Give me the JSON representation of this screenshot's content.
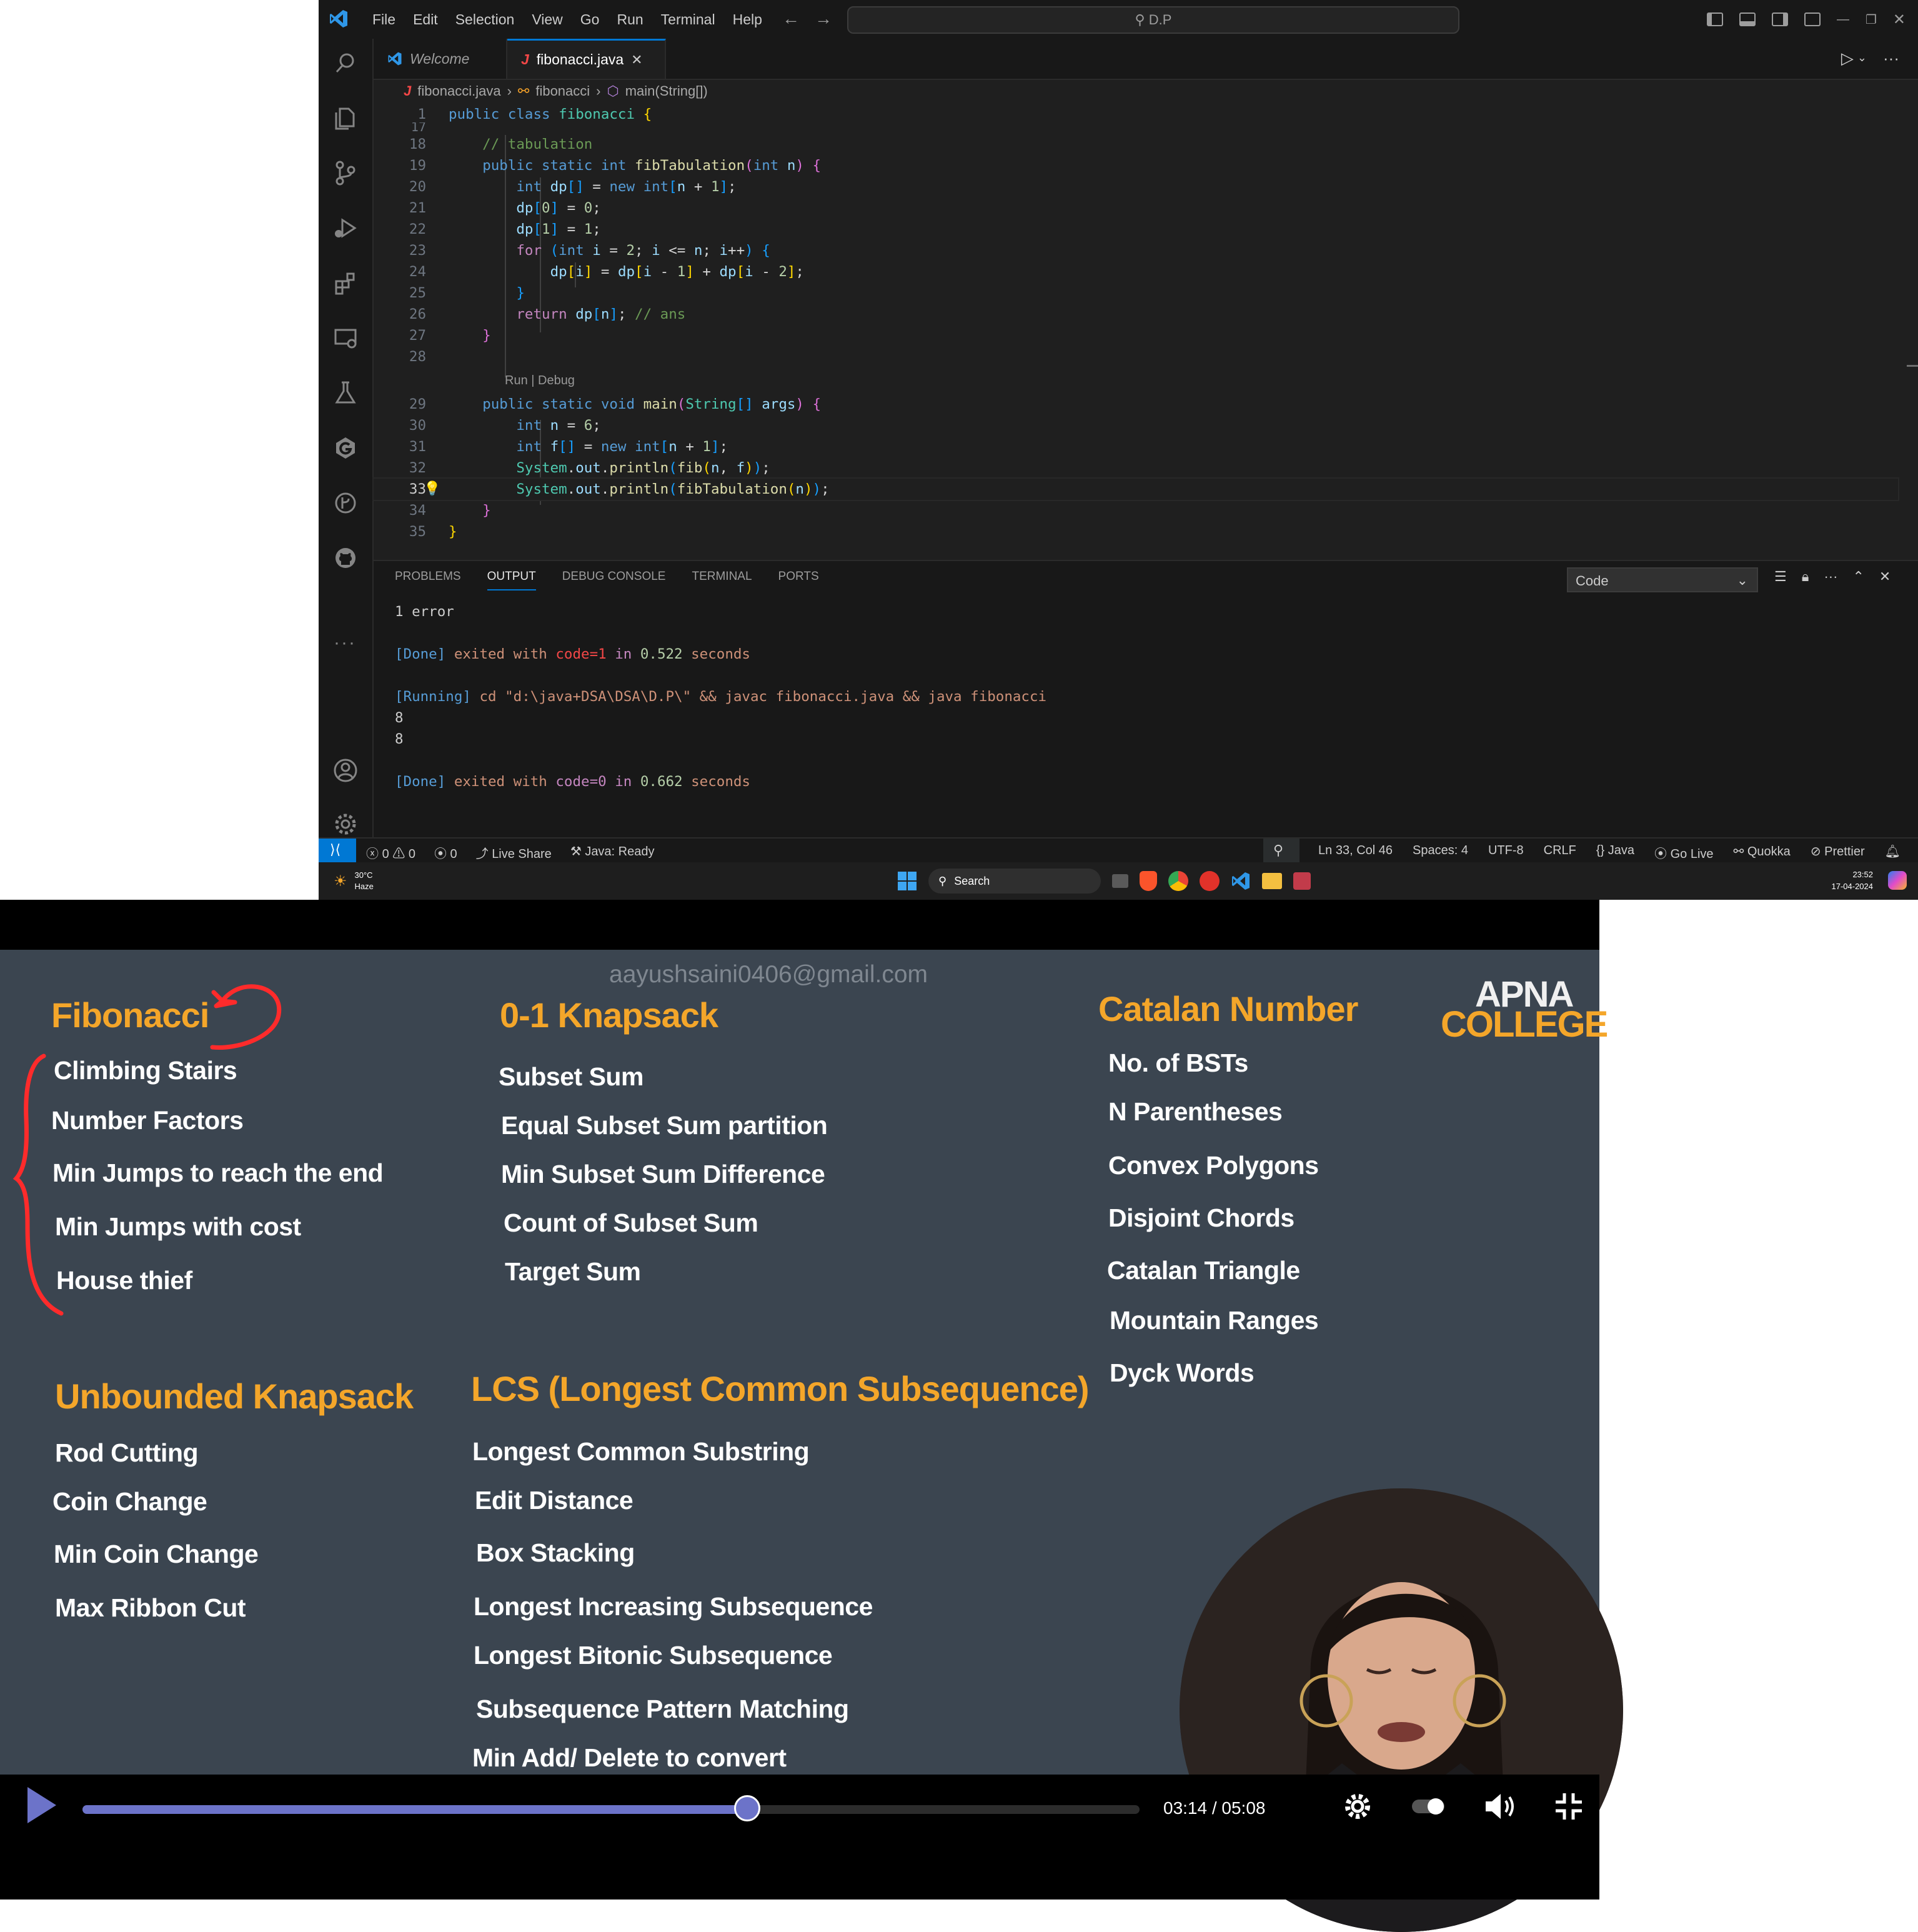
{
  "vscode": {
    "menu": [
      "File",
      "Edit",
      "Selection",
      "View",
      "Go",
      "Run",
      "Terminal",
      "Help"
    ],
    "search_text": "D.P",
    "tabs": [
      {
        "label": "Welcome"
      },
      {
        "label": "fibonacci.java"
      }
    ],
    "breadcrumb": [
      "fibonacci.java",
      "fibonacci",
      "main(String[])"
    ],
    "code_lines": [
      {
        "num": "1",
        "text": "public class fibonacci {"
      },
      {
        "num": "17",
        "text": ""
      },
      {
        "num": "18",
        "text": "    // tabulation"
      },
      {
        "num": "19",
        "text": "    public static int fibTabulation(int n) {"
      },
      {
        "num": "20",
        "text": "        int dp[] = new int[n + 1];"
      },
      {
        "num": "21",
        "text": "        dp[0] = 0;"
      },
      {
        "num": "22",
        "text": "        dp[1] = 1;"
      },
      {
        "num": "23",
        "text": "        for (int i = 2; i <= n; i++) {"
      },
      {
        "num": "24",
        "text": "            dp[i] = dp[i - 1] + dp[i - 2];"
      },
      {
        "num": "25",
        "text": "        }"
      },
      {
        "num": "26",
        "text": "        return dp[n]; // ans"
      },
      {
        "num": "27",
        "text": "    }"
      },
      {
        "num": "28",
        "text": ""
      },
      {
        "num": "29",
        "text": "    public static void main(String[] args) {"
      },
      {
        "num": "30",
        "text": "        int n = 6;"
      },
      {
        "num": "31",
        "text": "        int f[] = new int[n + 1];"
      },
      {
        "num": "32",
        "text": "        System.out.println(fib(n, f));"
      },
      {
        "num": "33",
        "text": "        System.out.println(fibTabulation(n));"
      },
      {
        "num": "34",
        "text": "    }"
      },
      {
        "num": "35",
        "text": "}"
      }
    ],
    "codelens": "Run | Debug",
    "panel": {
      "tabs": [
        "PROBLEMS",
        "OUTPUT",
        "DEBUG CONSOLE",
        "TERMINAL",
        "PORTS"
      ],
      "active_tab": "OUTPUT",
      "select_value": "Code",
      "output": {
        "error_line": "1 error",
        "done1": {
          "tag": "[Done]",
          "a": " exited with ",
          "code": "code=1",
          "b": " in ",
          "secs": "0.522",
          "c": " seconds"
        },
        "running": {
          "tag": "[Running]",
          "cmd": " cd \"d:\\java+DSA\\DSA\\D.P\\\" && javac fibonacci.java && java fibonacci"
        },
        "result1": "8",
        "result2": "8",
        "done2": {
          "tag": "[Done]",
          "a": " exited with ",
          "code": "code=0",
          "b": " in ",
          "secs": "0.662",
          "c": " seconds"
        }
      }
    },
    "status": {
      "errors": "0",
      "warnings": "0",
      "ports": "0",
      "live_share": "Live Share",
      "java": "Java: Ready",
      "position": "Ln 33, Col 46",
      "spaces": "Spaces: 4",
      "encoding": "UTF-8",
      "eol": "CRLF",
      "language": "Java",
      "go_live": "Go Live",
      "quokka": "Quokka",
      "prettier": "Prettier"
    }
  },
  "taskbar": {
    "weather_temp": "30°C",
    "weather_desc": "Haze",
    "search": "Search",
    "time": "23:52",
    "date": "17-04-2024"
  },
  "video": {
    "email": "aayushsaini0406@gmail.com",
    "logo_line1": "APNA",
    "logo_line2": "COLLEGE",
    "sections": {
      "fibonacci": {
        "title": "Fibonacci",
        "items": [
          "Climbing Stairs",
          "Number Factors",
          "Min Jumps to reach the end",
          "Min Jumps with cost",
          "House thief"
        ]
      },
      "knapsack01": {
        "title": "0-1 Knapsack",
        "items": [
          "Subset Sum",
          "Equal Subset Sum partition",
          "Min Subset Sum Difference",
          "Count of Subset Sum",
          "Target Sum"
        ]
      },
      "catalan": {
        "title": "Catalan Number",
        "items": [
          "No. of BSTs",
          "N Parentheses",
          "Convex Polygons",
          "Disjoint Chords",
          "Catalan Triangle",
          "Mountain Ranges",
          "Dyck Words"
        ]
      },
      "unbounded": {
        "title": "Unbounded Knapsack",
        "items": [
          "Rod Cutting",
          "Coin Change",
          "Min Coin Change",
          "Max Ribbon Cut"
        ]
      },
      "lcs": {
        "title": "LCS (Longest Common Subsequence)",
        "items": [
          "Longest Common Substring",
          "Edit Distance",
          "Box Stacking",
          "Longest Increasing Subsequence",
          "Longest Bitonic Subsequence",
          "Subsequence Pattern Matching",
          "Min Add/ Delete to convert"
        ]
      }
    },
    "player": {
      "time": "03:14 / 05:08",
      "progress": 0.629,
      "accent": "#6c73c9"
    }
  }
}
